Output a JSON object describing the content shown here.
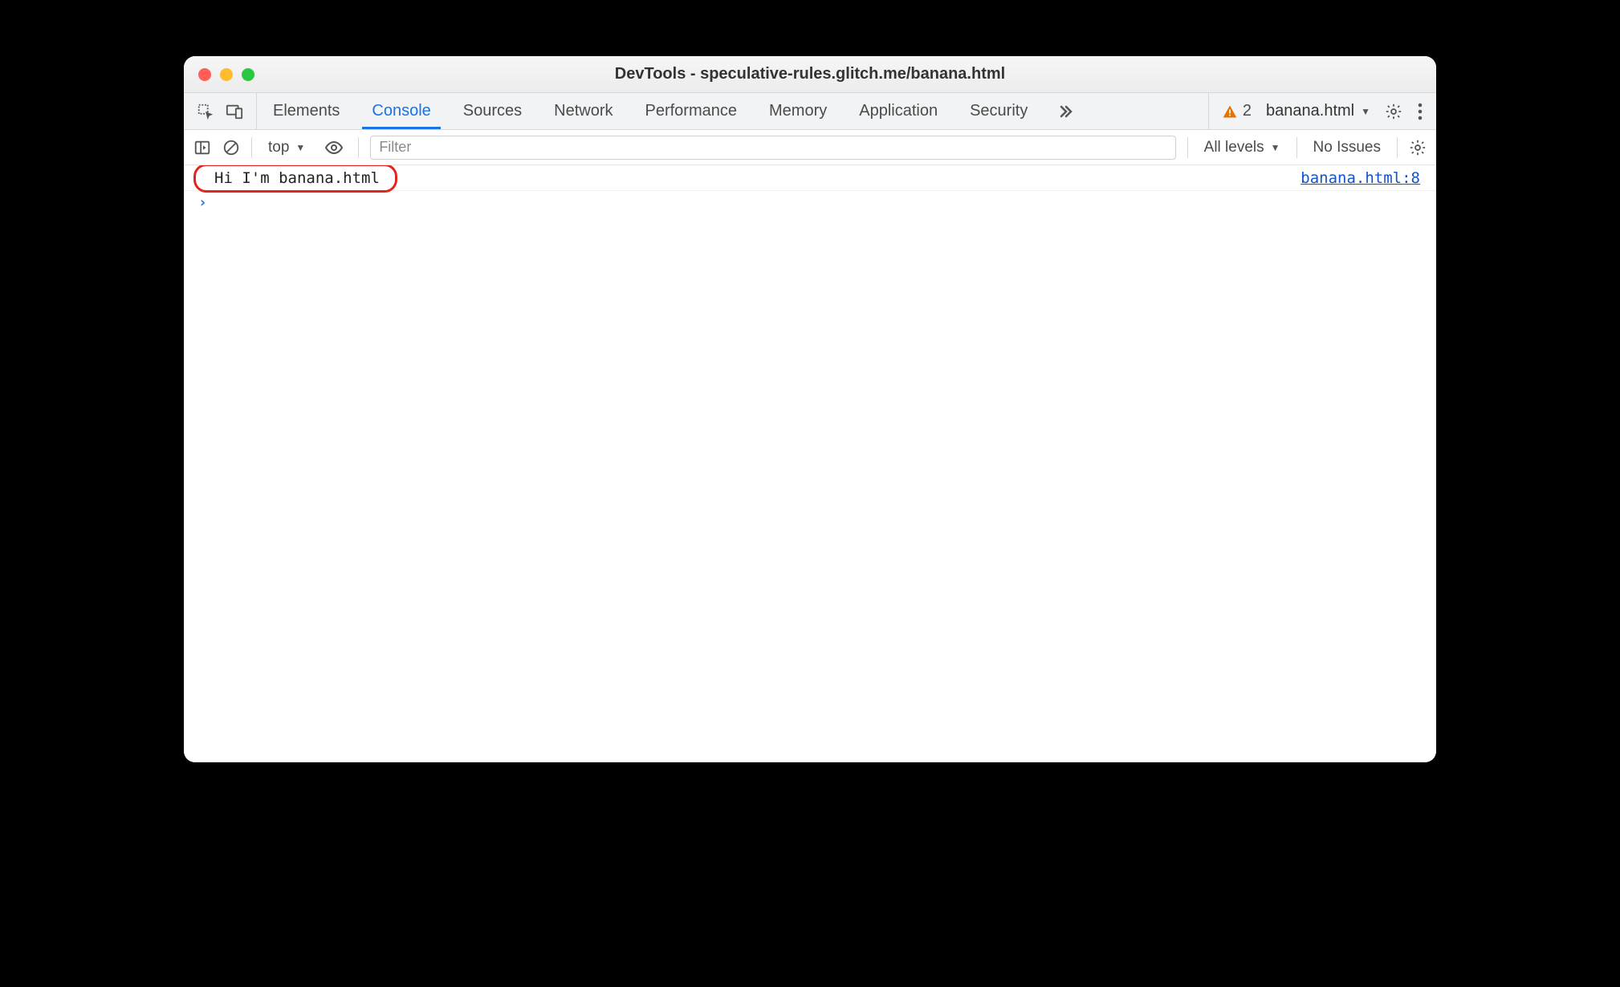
{
  "window": {
    "title": "DevTools - speculative-rules.glitch.me/banana.html"
  },
  "tabs": {
    "items": [
      {
        "label": "Elements"
      },
      {
        "label": "Console"
      },
      {
        "label": "Sources"
      },
      {
        "label": "Network"
      },
      {
        "label": "Performance"
      },
      {
        "label": "Memory"
      },
      {
        "label": "Application"
      },
      {
        "label": "Security"
      }
    ],
    "active_index": 1,
    "warning_count": "2",
    "target_label": "banana.html"
  },
  "filter": {
    "context_label": "top",
    "filter_placeholder": "Filter",
    "levels_label": "All levels",
    "issues_label": "No Issues"
  },
  "console": {
    "log_message": "Hi I'm banana.html",
    "log_source": "banana.html:8",
    "prompt": "›"
  }
}
